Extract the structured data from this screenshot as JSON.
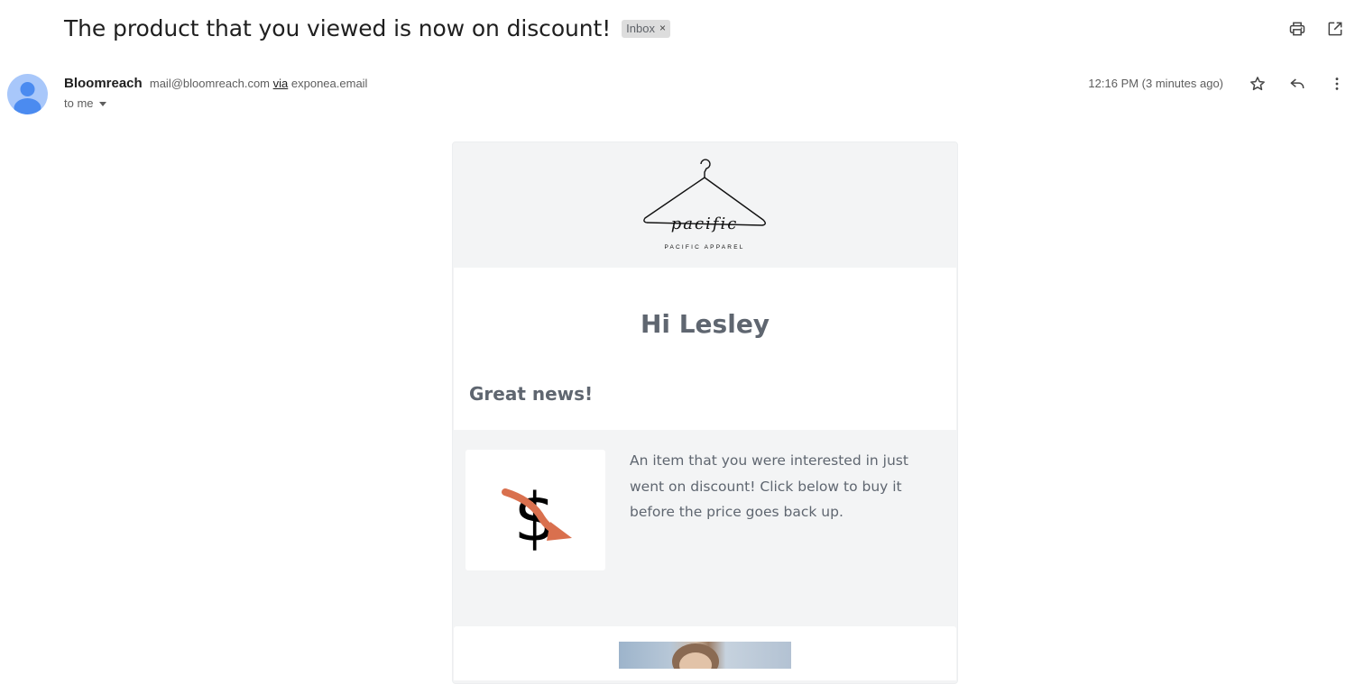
{
  "email": {
    "subject": "The product that you viewed is now on discount!",
    "label": "Inbox",
    "label_remove": "×",
    "sender_name": "Bloomreach",
    "sender_email": "mail@bloomreach.com",
    "via_label": "via",
    "via_domain": "exponea.email",
    "recipient": "to me",
    "timestamp": "12:16 PM (3 minutes ago)"
  },
  "icons": {
    "print": "print-icon",
    "open_new_window": "open-in-new-window-icon",
    "star": "star-icon",
    "reply": "reply-icon",
    "more": "more-vert-icon",
    "avatar": "person-avatar-icon"
  },
  "body": {
    "brand_name": "PACIFIC APPAREL",
    "brand_script": "pacific",
    "greeting": "Hi Lesley",
    "headline": "Great news!",
    "message": "An item that you were interested in just went on discount! Click below to buy it before the price goes back up.",
    "product_icon": "price-drop-dollar-icon"
  },
  "colors": {
    "card_bg": "#f3f4f5",
    "text_muted": "#5f6670",
    "accent_arrow": "#d9704e",
    "avatar_bg": "#a8c7fa",
    "avatar_fg": "#4b8bf0"
  }
}
